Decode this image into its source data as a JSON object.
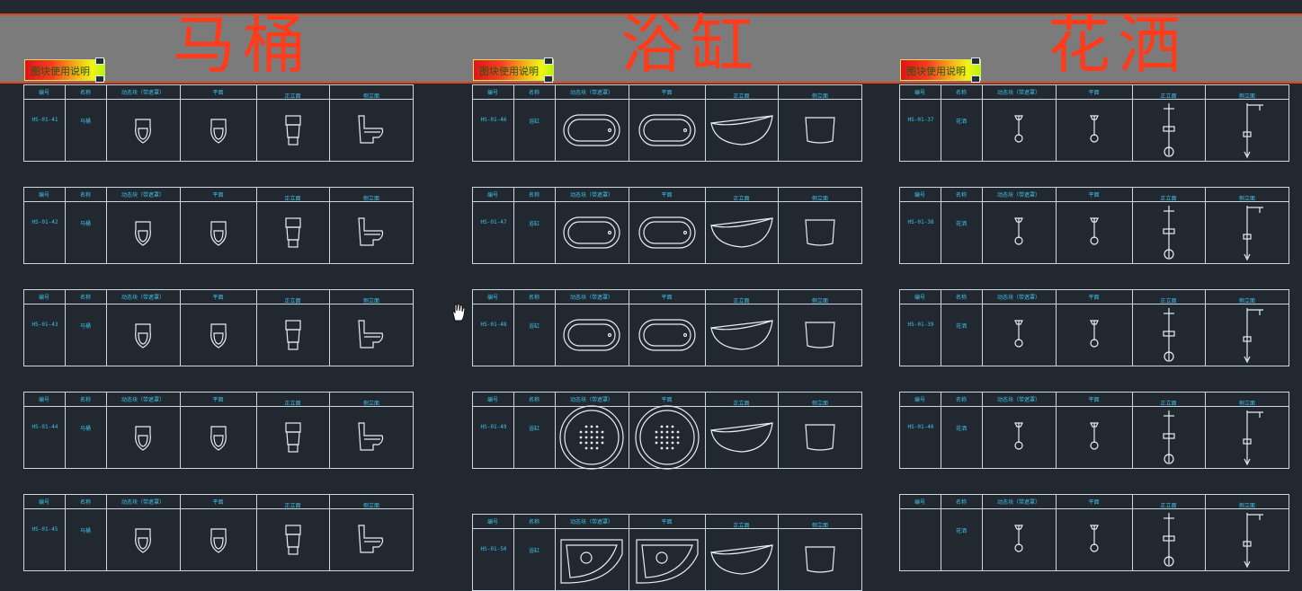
{
  "banner": {
    "titles": [
      "马桶",
      "浴缸",
      "花洒"
    ],
    "guide_label": "图块使用说明"
  },
  "headers": [
    "编号",
    "名称",
    "动态块（带遮罩）",
    "平面",
    "正立面",
    "侧立面"
  ],
  "colors": {
    "background": "#212830",
    "banner": "#7b7b7b",
    "title": "#ff3b1a",
    "text_cyan": "#3fc2ea",
    "lines": "#cfd8e0"
  },
  "sections": [
    {
      "title": "马桶",
      "rows": [
        {
          "code": "HS-01-41",
          "name": "马桶",
          "icons": [
            "toilet-top-icon",
            "toilet-top-icon",
            "toilet-front-icon",
            "toilet-side-icon"
          ]
        },
        {
          "code": "HS-01-42",
          "name": "马桶",
          "icons": [
            "toilet-top-icon",
            "toilet-top-icon",
            "toilet-front-icon",
            "toilet-side-icon"
          ]
        },
        {
          "code": "HS-01-43",
          "name": "马桶",
          "icons": [
            "toilet-top-icon",
            "toilet-top-icon",
            "toilet-front-icon",
            "toilet-side-icon"
          ]
        },
        {
          "code": "HS-01-44",
          "name": "马桶",
          "icons": [
            "toilet-top-icon",
            "toilet-top-icon",
            "toilet-front-icon",
            "toilet-side-icon"
          ]
        },
        {
          "code": "HS-01-45",
          "name": "马桶",
          "icons": [
            "toilet-top-icon",
            "toilet-top-icon",
            "toilet-front-icon",
            "toilet-side-icon"
          ]
        }
      ]
    },
    {
      "title": "浴缸",
      "rows": [
        {
          "code": "HS-01-46",
          "name": "浴缸",
          "icons": [
            "bathtub-top-icon",
            "bathtub-top-icon",
            "bathtub-front-icon",
            "bathtub-side-icon"
          ]
        },
        {
          "code": "HS-01-47",
          "name": "浴缸",
          "icons": [
            "bathtub-top-icon",
            "bathtub-top-icon",
            "bathtub-front-icon",
            "bathtub-side-icon"
          ]
        },
        {
          "code": "HS-01-48",
          "name": "浴缸",
          "icons": [
            "bathtub-top-icon",
            "bathtub-top-icon",
            "bathtub-front-icon",
            "bathtub-side-icon"
          ]
        },
        {
          "code": "HS-01-49",
          "name": "浴缸",
          "icons": [
            "round-bathtub-top-icon",
            "round-bathtub-top-icon",
            "bathtub-front-icon",
            "bathtub-side-icon"
          ]
        },
        {
          "code": "HS-01-50",
          "name": "浴缸",
          "icons": [
            "corner-bathtub-top-icon",
            "corner-bathtub-top-icon",
            "bathtub-front-icon",
            "bathtub-side-icon"
          ]
        }
      ]
    },
    {
      "title": "花洒",
      "rows": [
        {
          "code": "HS-01-37",
          "name": "花洒",
          "icons": [
            "shower-top-icon",
            "shower-top-icon",
            "shower-front-icon",
            "shower-side-icon"
          ]
        },
        {
          "code": "HS-01-38",
          "name": "花洒",
          "icons": [
            "shower-top-icon",
            "shower-top-icon",
            "shower-front-icon",
            "shower-side-icon"
          ]
        },
        {
          "code": "HS-01-39",
          "name": "花洒",
          "icons": [
            "shower-top-icon",
            "shower-top-icon",
            "shower-front-icon",
            "shower-side-icon"
          ]
        },
        {
          "code": "HS-01-40",
          "name": "花洒",
          "icons": [
            "shower-top-icon",
            "shower-top-icon",
            "shower-front-icon",
            "shower-side-icon"
          ]
        },
        {
          "code": "",
          "name": "花洒",
          "icons": [
            "shower-top-icon",
            "shower-top-icon",
            "shower-front-icon",
            "shower-side-icon"
          ]
        }
      ]
    }
  ],
  "cursor": {
    "icon": "hand-cursor-icon"
  }
}
